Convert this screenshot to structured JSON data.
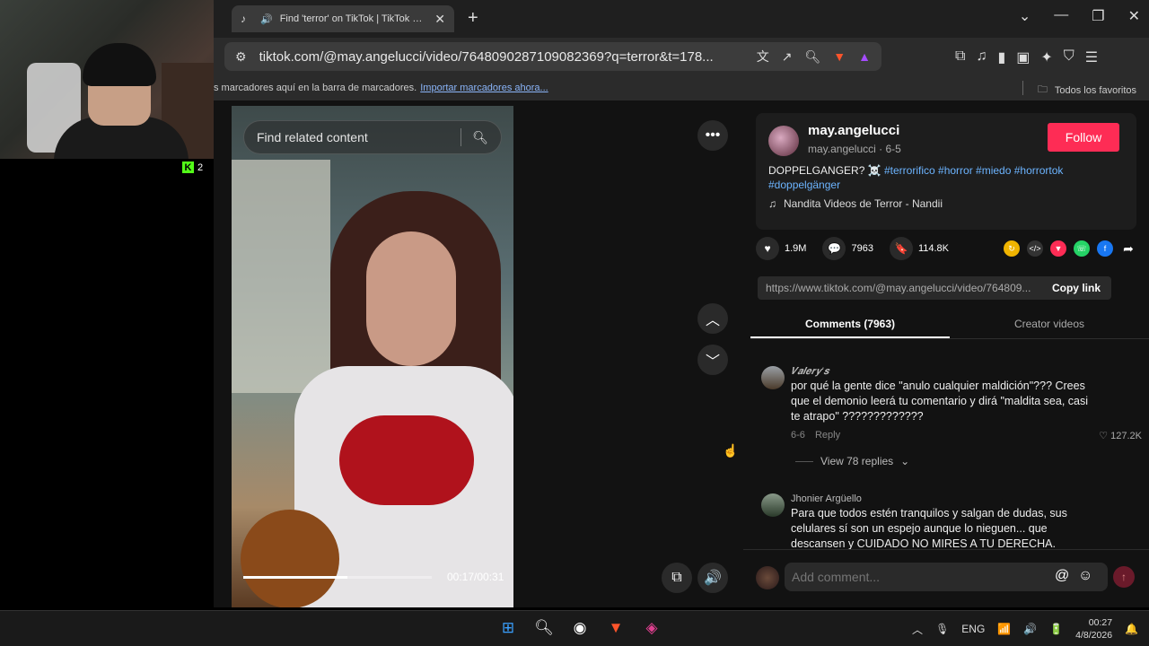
{
  "webcam": {
    "badge_count": "2"
  },
  "browser": {
    "tab_title": "Find 'terror' on TikTok | TikTok Search",
    "url": "tiktok.com/@may.angelucci/video/7648090287109082369?q=terror&t=178...",
    "bookmarks_text": "s marcadores aquí en la barra de marcadores.",
    "bookmarks_import": "Importar marcadores ahora...",
    "all_favorites": "Todos los favoritos"
  },
  "video": {
    "search_placeholder": "Find related content",
    "time": "00:17/00:31",
    "progress": 0.55
  },
  "author": {
    "name": "may.angelucci",
    "sub": "may.angelucci · 6-5",
    "follow_label": "Follow",
    "caption_text": "DOPPELGANGER? ☠️",
    "caption_tags": "#terrorifico #horror #miedo #horrortok #doppelgänger",
    "music": "Nandita Videos de Terror - Nandii"
  },
  "stats": {
    "likes": "1.9M",
    "comments": "7963",
    "saves": "114.8K"
  },
  "share": {
    "link": "https://www.tiktok.com/@may.angelucci/video/764809...",
    "copy_label": "Copy link"
  },
  "tabs": {
    "comments": "Comments (7963)",
    "creator": "Creator videos"
  },
  "comments": [
    {
      "name": "𝑽𝒂𝒍𝒆𝒓𝒚'𝒔",
      "text": "por qué la gente dice \"anulo cualquier maldición\"??? Crees que el demonio leerá tu comentario y dirá \"maldita sea, casi te atrapo\" ?????????????",
      "date": "6-6",
      "reply": "Reply",
      "likes": "127.2K",
      "view_replies": "View 78 replies"
    },
    {
      "name": "Jhonier Argüello",
      "text": "Para que todos estén tranquilos y salgan de dudas, sus celulares sí son un espejo aunque lo nieguen... que descansen y CUIDADO NO MIRES A TU DERECHA."
    }
  ],
  "comment_input": {
    "placeholder": "Add comment..."
  },
  "taskbar": {
    "lang": "ENG",
    "time": "00:27",
    "date": "4/8/2026"
  },
  "colors": {
    "follow": "#fe2c55",
    "tag": "#6cb4ff"
  }
}
